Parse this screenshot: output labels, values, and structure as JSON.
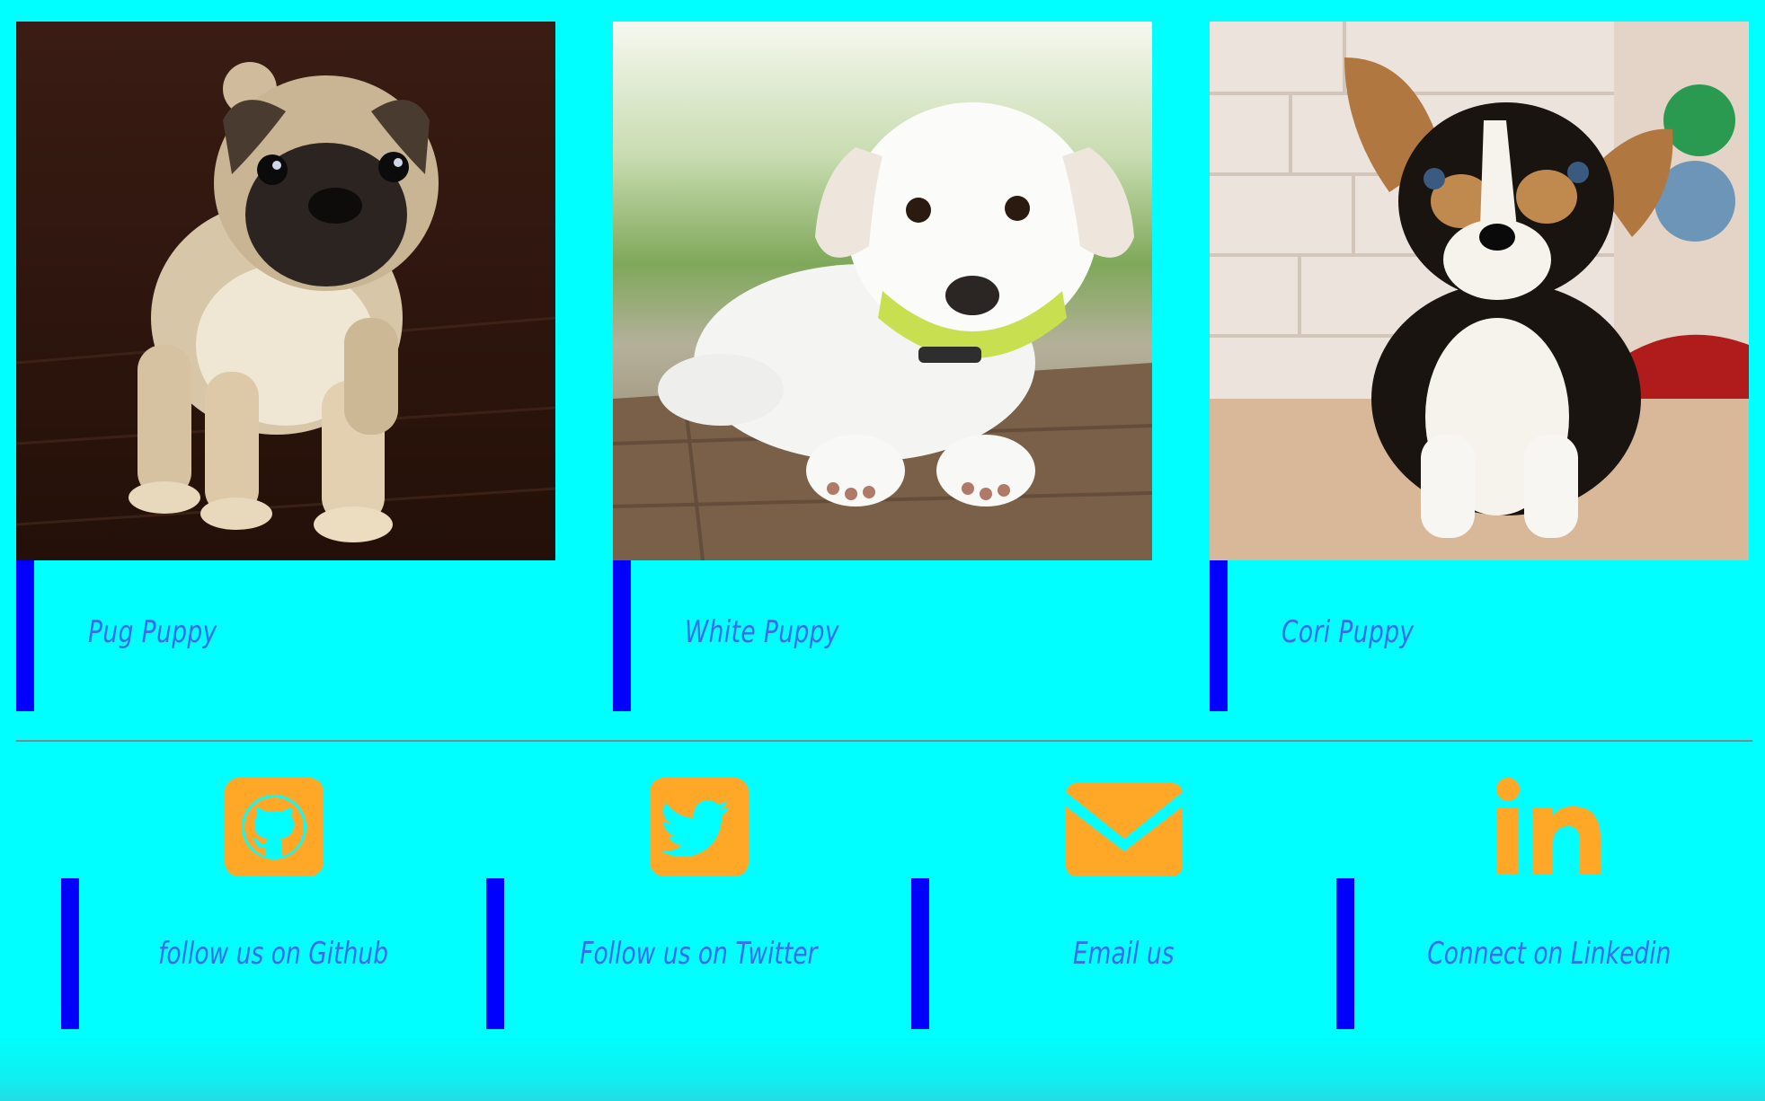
{
  "puppies": [
    {
      "name": "Pug Puppy",
      "image": "pug-puppy-photo"
    },
    {
      "name": "White Puppy",
      "image": "white-puppy-photo"
    },
    {
      "name": "Cori Puppy",
      "image": "corgi-puppy-photo"
    }
  ],
  "social": [
    {
      "label": "follow us on Github",
      "icon": "github-icon"
    },
    {
      "label": "Follow us on Twitter",
      "icon": "twitter-icon"
    },
    {
      "label": "Email us",
      "icon": "email-icon"
    },
    {
      "label": "Connect on Linkedin",
      "icon": "linkedin-icon"
    }
  ],
  "colors": {
    "background": "#00FFFF",
    "accent_bar": "#0000FF",
    "caption_text": "#3B6CF0",
    "icon": "#FFA726",
    "divider": "#7A8C8C"
  }
}
